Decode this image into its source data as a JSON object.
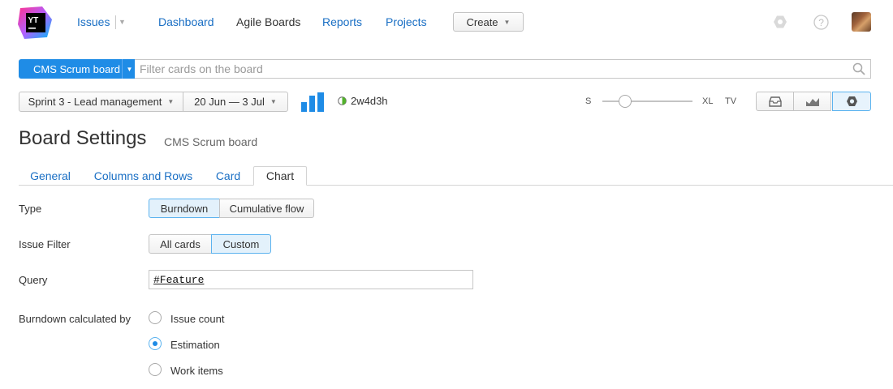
{
  "nav": {
    "logo_text": "YT",
    "issues": "Issues",
    "dashboard": "Dashboard",
    "agile_boards": "Agile Boards",
    "reports": "Reports",
    "projects": "Projects",
    "create": "Create"
  },
  "filter": {
    "board_name": "CMS Scrum board",
    "placeholder": "Filter cards on the board"
  },
  "sprint": {
    "name": "Sprint 3 - Lead management",
    "dates": "20 Jun — 3 Jul",
    "time_left": "2w4d3h"
  },
  "card_size": {
    "small": "S",
    "large": "XL",
    "tv": "TV",
    "level": 0.25
  },
  "page": {
    "title": "Board Settings",
    "subtitle": "CMS Scrum board"
  },
  "tabs": [
    "General",
    "Columns and Rows",
    "Card",
    "Chart"
  ],
  "active_tab": "Chart",
  "form": {
    "type_label": "Type",
    "type_options": [
      "Burndown",
      "Cumulative flow"
    ],
    "type_selected": "Burndown",
    "filter_label": "Issue Filter",
    "filter_options": [
      "All cards",
      "Custom"
    ],
    "filter_selected": "Custom",
    "query_label": "Query",
    "query_value": "#Feature",
    "calc_label": "Burndown calculated by",
    "calc_options": [
      "Issue count",
      "Estimation",
      "Work items"
    ],
    "calc_selected": "Estimation"
  },
  "colors": {
    "accent": "#1f8ce6",
    "link": "#1a6fc4",
    "active_bg": "#e3f1fb"
  }
}
